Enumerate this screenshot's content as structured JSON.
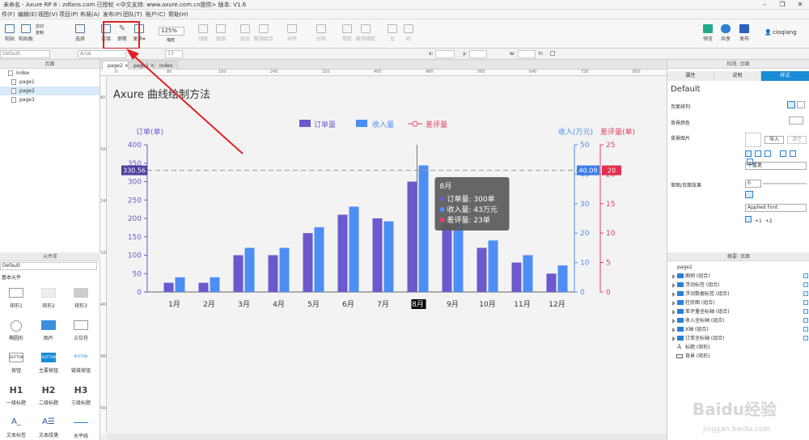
{
  "window": {
    "title": "未命名 - Axure RP 8 : zdfans.com 已授权      <中文支持: www.axure.com.cn提供> 版本: V1.6"
  },
  "menu": [
    "件(F)",
    "编辑(E)",
    "视图(V)",
    "项目(P)",
    "布局(A)",
    "发布(P)",
    "团队(T)",
    "账户(C)",
    "帮助(H)"
  ],
  "toolbar": {
    "left_labels": [
      "粘贴",
      "剪切",
      "复制",
      "粘贴板"
    ],
    "select_label": "选择",
    "connect_label": "连接",
    "select_mode": "选择",
    "pen_label": "钢笔",
    "more_label": "更多▾",
    "zoom_value": "125%",
    "zoom_label": "缩放",
    "mid_labels": [
      "顶层",
      "底层",
      "组合",
      "取消组合",
      "对齐",
      "分布",
      "锁定",
      "取消锁定",
      "左",
      "右"
    ],
    "right_labels": [
      "预览",
      "共享",
      "发布"
    ],
    "user": "cioqiang"
  },
  "stylebar": {
    "style": "Default",
    "font": "Arial",
    "size": "13",
    "x": "x:",
    "y": "y:",
    "w": "w:",
    "h": "h:"
  },
  "pages": {
    "header": "页面",
    "items": [
      "index",
      "page1",
      "page2",
      "page3"
    ],
    "selected": "page2"
  },
  "library": {
    "header": "元件库",
    "selector": "Default",
    "category": "基本元件",
    "items": [
      "矩形1",
      "矩形2",
      "矩形3",
      "椭圆形",
      "图片",
      "占位符",
      "按钮",
      "主要按钮",
      "链接按钮",
      "一级标题",
      "二级标题",
      "三级标题",
      "文本标签",
      "文本段落",
      "水平线"
    ],
    "heading_glyphs": [
      "H1",
      "H2",
      "H3"
    ],
    "button_glyph": "BUTTON"
  },
  "tabs": [
    "page2",
    "page1",
    "index"
  ],
  "ruler": {
    "h_ticks": [
      "0",
      "80",
      "160",
      "240",
      "320",
      "400",
      "480",
      "560",
      "640",
      "720",
      "800"
    ],
    "v_ticks": [
      "80",
      "160",
      "240",
      "320",
      "400",
      "480",
      "560"
    ]
  },
  "canvas": {
    "title": "Axure 曲线绘制方法"
  },
  "chart_data": {
    "type": "bar",
    "categories": [
      "1月",
      "2月",
      "3月",
      "4月",
      "5月",
      "6月",
      "7月",
      "8月",
      "9月",
      "10月",
      "11月",
      "12月"
    ],
    "series": [
      {
        "name": "订单量",
        "axis": "left",
        "values": [
          25,
          25,
          100,
          100,
          160,
          210,
          200,
          300,
          190,
          120,
          80,
          50
        ],
        "color": "#6a5acd"
      },
      {
        "name": "收入量",
        "axis": "right",
        "values": [
          5,
          5,
          15,
          15,
          22,
          29,
          24,
          43,
          24,
          17.5,
          12.5,
          9
        ],
        "color": "#4d8ef5"
      },
      {
        "name": "差评量",
        "axis": "right2",
        "values": [],
        "color": "#e04060"
      }
    ],
    "left_axis": {
      "label": "订单(单)",
      "ylim": [
        0,
        400
      ],
      "ticks": [
        "0",
        "50",
        "100",
        "150",
        "200",
        "250",
        "300",
        "350",
        "400"
      ]
    },
    "right_axis": {
      "label": "收入(万元)",
      "ylim": [
        0,
        50
      ],
      "ticks": [
        "0",
        "10",
        "20",
        "30",
        "40",
        "50"
      ]
    },
    "right_axis2": {
      "label": "差评量(单)",
      "ylim": [
        0,
        25
      ],
      "ticks": [
        "0",
        "5",
        "10",
        "15",
        "20",
        "25"
      ]
    },
    "legend": "top-center",
    "crosshair": {
      "left_value": "330.56",
      "right_value": "40.09",
      "right2_value": "20",
      "category": "8月"
    },
    "tooltip": {
      "title": "8月",
      "lines": [
        "订单量: 300单",
        "收入量: 43万元",
        "差评量: 23单"
      ]
    }
  },
  "right_panel": {
    "header": "检视: 页面",
    "tabs": [
      "属性",
      "说明",
      "样式"
    ],
    "active_tab": "样式",
    "style_name": "Default",
    "rows": [
      "页面排列",
      "背景颜色",
      "背景图片",
      "草图/页面效果"
    ],
    "import_btn": "导入",
    "clear_btn": "清空",
    "repeat": "不重复",
    "sketch_value": "0",
    "font_value": "Applied Font",
    "plus_btns": [
      "+1",
      "+2"
    ]
  },
  "outline": {
    "header": "概要: 页面",
    "root": "page2",
    "items": [
      "图例 (组合)",
      "浮动标签 (组合)",
      "浮动数据标签 (组合)",
      "柱状图 (组合)",
      "差评量坐标轴 (组合)",
      "收入坐标轴 (组合)",
      "X轴 (组合)",
      "订单坐标轴 (组合)",
      "标题 (矩形)",
      "背景 (矩形)"
    ]
  },
  "watermark": {
    "brand": "Baidu经验",
    "url": "jingyan.baidu.com"
  }
}
